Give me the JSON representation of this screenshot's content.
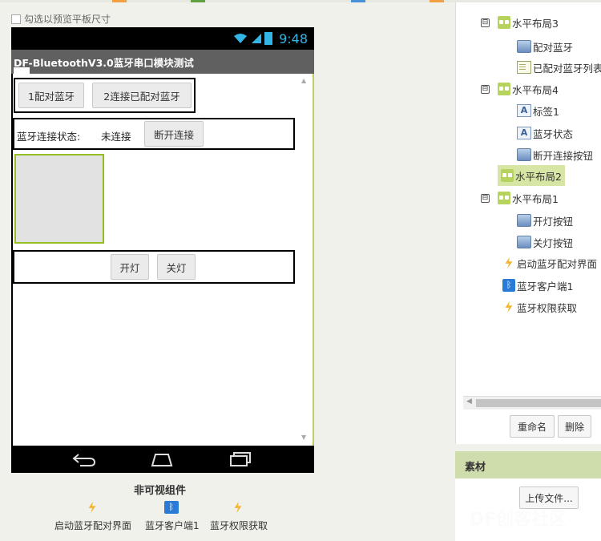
{
  "viewer": {
    "preview_checkbox_label": "勾选以预览平板尺寸",
    "phone": {
      "time": "9:48",
      "app_title": "DF-BluetoothV3.0蓝牙串口模块测试",
      "row1": {
        "button1": "1配对蓝牙",
        "button2": "2连接已配对蓝牙"
      },
      "row2": {
        "label_prefix": "蓝牙连接状态:",
        "label_status": "未连接",
        "disconnect_button": "断开连接"
      },
      "row3": {
        "on_button": "开灯",
        "off_button": "关灯"
      }
    },
    "non_visible_title": "非可视组件",
    "non_visible": [
      {
        "name": "启动蓝牙配对界面",
        "icon": "lightning-icon"
      },
      {
        "name": "蓝牙客户端1",
        "icon": "bluetooth-icon"
      },
      {
        "name": "蓝牙权限获取",
        "icon": "lightning-icon"
      }
    ]
  },
  "components": {
    "tree": [
      {
        "label": "水平布局3",
        "icon": "hbox-icon",
        "toggle": "⊟"
      },
      {
        "label": "配对蓝牙",
        "icon": "button-icon"
      },
      {
        "label": "已配对蓝牙列表",
        "icon": "listpicker-icon"
      },
      {
        "label": "水平布局4",
        "icon": "hbox-icon",
        "toggle": "⊟"
      },
      {
        "label": "标签1",
        "icon": "label-icon"
      },
      {
        "label": "蓝牙状态",
        "icon": "label-icon"
      },
      {
        "label": "断开连接按钮",
        "icon": "button-icon"
      },
      {
        "label": "水平布局2",
        "icon": "hbox-icon",
        "selected": true
      },
      {
        "label": "水平布局1",
        "icon": "hbox-icon",
        "toggle": "⊟"
      },
      {
        "label": "开灯按钮",
        "icon": "button-icon"
      },
      {
        "label": "关灯按钮",
        "icon": "button-icon"
      },
      {
        "label": "启动蓝牙配对界面",
        "icon": "lightning-icon"
      },
      {
        "label": "蓝牙客户端1",
        "icon": "bluetooth-icon"
      },
      {
        "label": "蓝牙权限获取",
        "icon": "lightning-icon"
      }
    ],
    "rename_button": "重命名",
    "delete_button": "删除"
  },
  "media": {
    "title": "素材",
    "upload_button": "上传文件..."
  },
  "watermark": "DF创客社区",
  "colors": {
    "accent_green": "#b5d35d",
    "status_blue": "#33b5e5",
    "selection": "#d7e6a4"
  }
}
